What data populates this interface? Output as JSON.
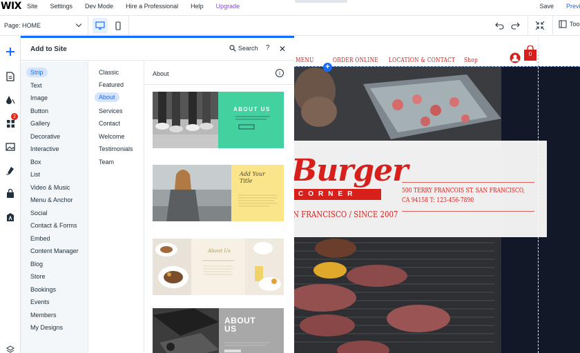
{
  "topbar": {
    "logo": "WIX",
    "menu": [
      "Site",
      "Settings",
      "Dev Mode",
      "Hire a Professional",
      "Help",
      "Upgrade"
    ],
    "save": "Save",
    "preview": "Preview"
  },
  "toolbar": {
    "page_label": "Page: HOME",
    "tools_label": "Tools"
  },
  "leftbar": {
    "badge_count": "2"
  },
  "add_panel": {
    "title": "Add to Site",
    "search_label": "Search",
    "help": "?",
    "close": "✕",
    "categories": [
      "Strip",
      "Text",
      "Image",
      "Button",
      "Gallery",
      "Decorative",
      "Interactive",
      "Box",
      "List",
      "Video & Music",
      "Menu & Anchor",
      "Social",
      "Contact & Forms",
      "Embed",
      "Content Manager",
      "Blog",
      "Store",
      "Bookings",
      "Events",
      "Members",
      "My Designs"
    ],
    "active_category": "Strip",
    "subcategories": [
      "Classic",
      "Featured",
      "About",
      "Services",
      "Contact",
      "Welcome",
      "Testimonials",
      "Team"
    ],
    "active_subcategory": "About",
    "section_title": "About",
    "info": "i",
    "thumbs": {
      "t1_heading": "ABOUT US",
      "t2_heading": "Add Your Title",
      "t3_heading": "About Us",
      "t4_heading": "ABOUT US"
    }
  },
  "site": {
    "nav": [
      "MENU",
      "ORDER ONLINE",
      "LOCATION & CONTACT",
      "Shop"
    ],
    "cart_count": "0",
    "title": "Burger",
    "corner": "CORNER",
    "since": "N FRANCISCO / SINCE 2007",
    "address_line1": "500 TERRY FRANCOIS ST. SAN FRANCISCO,",
    "address_line2": "CA 94158   T: 123-456-7890"
  },
  "colors": {
    "accent": "#116dff",
    "brand_red": "#d7201b",
    "upgrade": "#8b3ff7",
    "panel_bg": "#f3f7fa",
    "teal": "#43d1a0",
    "yellow": "#fbe58a"
  }
}
